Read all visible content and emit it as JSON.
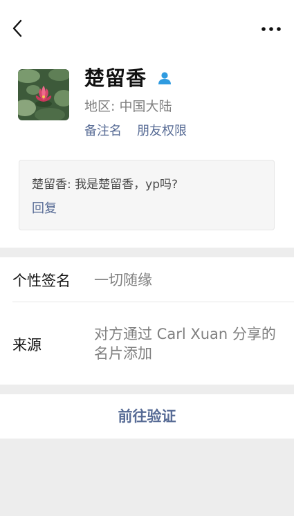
{
  "profile": {
    "name": "楚留香",
    "region": "地区: 中国大陆",
    "avatar_icon": "lotus-avatar-photo",
    "badge_icon": "person-icon",
    "accent": "#576b95"
  },
  "links": {
    "remark": "备注名",
    "permissions": "朋友权限"
  },
  "message": {
    "text": "楚留香: 我是楚留香，yp吗?",
    "reply": "回复"
  },
  "details": {
    "signature_label": "个性签名",
    "signature_value": "一切随缘",
    "source_label": "来源",
    "source_value": "对方通过 Carl Xuan 分享的名片添加"
  },
  "actions": {
    "verify": "前往验证"
  },
  "nav": {
    "back_icon": "back-chevron-icon",
    "more_icon": "more-dots-icon"
  }
}
